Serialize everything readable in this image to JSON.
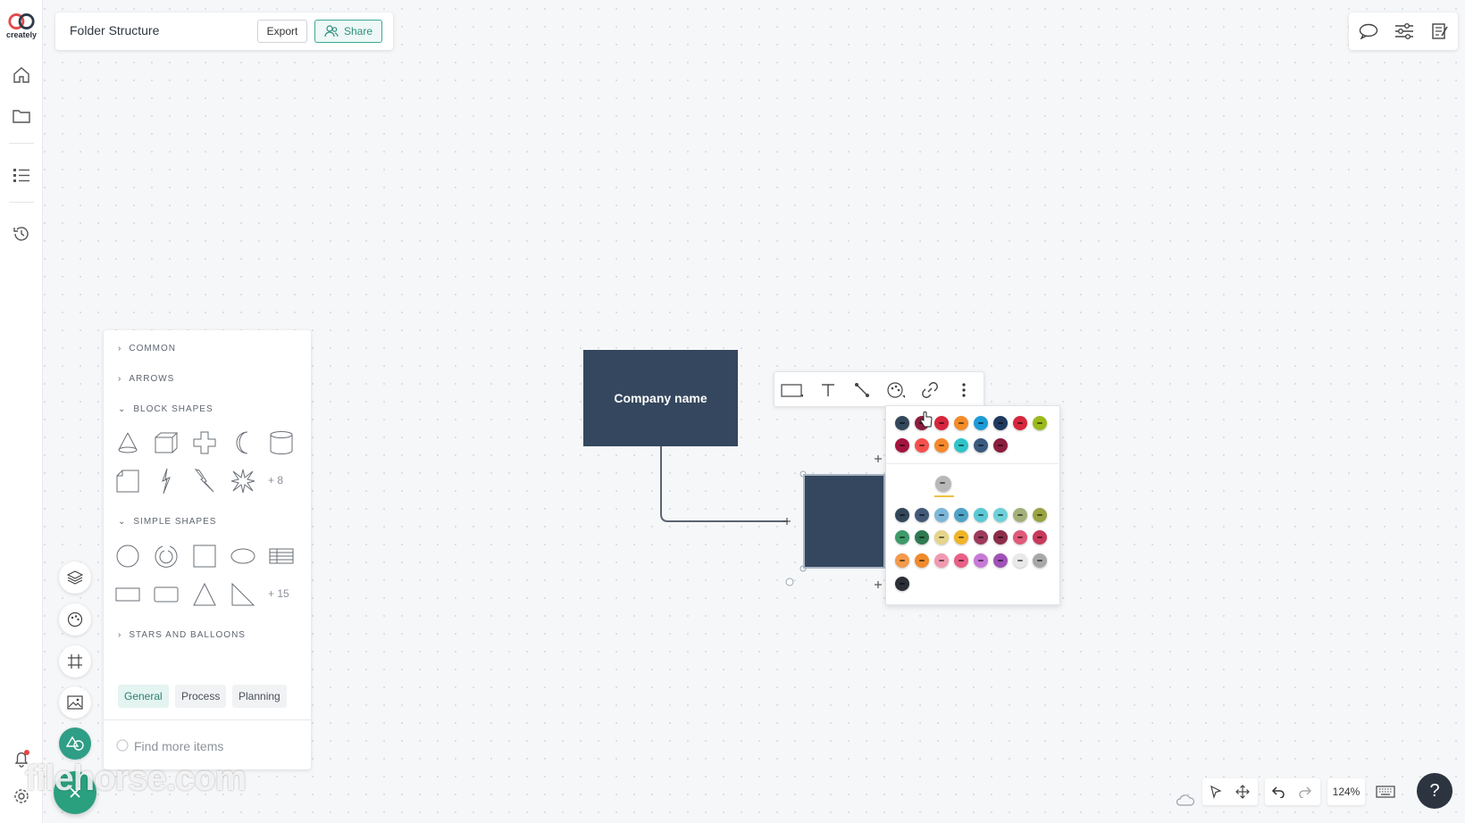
{
  "app": {
    "logo_text": "creately"
  },
  "header": {
    "title": "Folder Structure",
    "export_label": "Export",
    "share_label": "Share"
  },
  "left_rail": {
    "icons": [
      "home-icon",
      "folder-icon",
      "outline-icon",
      "history-icon",
      "bell-icon",
      "gear-icon"
    ],
    "notification_color": "#e64545"
  },
  "top_right": {
    "icons": [
      "comment-icon",
      "settings-sliders-icon",
      "notes-icon"
    ]
  },
  "shapes_panel": {
    "sections": {
      "common": "COMMON",
      "arrows": "ARROWS",
      "block_shapes": "BLOCK SHAPES",
      "simple_shapes": "SIMPLE SHAPES",
      "stars_balloons": "STARS AND BALLOONS"
    },
    "block_more": "+ 8",
    "simple_more": "+ 15",
    "tabs": [
      "General",
      "Process",
      "Planning"
    ],
    "active_tab": "General",
    "search_placeholder": "Find more items"
  },
  "canvas": {
    "company_box_label": "Company name",
    "shape_fill": "#35475e"
  },
  "context_toolbar": {
    "tools": [
      "shape-icon",
      "text-icon",
      "connector-icon",
      "palette-icon",
      "link-icon",
      "more-icon"
    ]
  },
  "palette": {
    "row1": [
      "#33475b",
      "#8c1d3e",
      "#d7263d",
      "#f28c28",
      "#1e9bd7",
      "#1f3a5f",
      "#d7263d",
      "#9bb91a"
    ],
    "row2": [
      "#a3153f",
      "#f4514e",
      "#f5892b",
      "#2ec4c9",
      "#3b5a80",
      "#8c1d3e"
    ],
    "selected_preview": "#b8b8b8",
    "theme_row1": [
      "#33475b",
      "#415a77",
      "#7cb7d9",
      "#4fa3c7",
      "#5bc8d5",
      "#6dd1d8",
      "#a4b07a",
      "#9aa342"
    ],
    "theme_row2": [
      "#3e9a6a",
      "#2f7a52",
      "#e5d48a",
      "#f0b429",
      "#9c3b5b",
      "#8c2d4a",
      "#e05a7a",
      "#c73a5a"
    ],
    "theme_row3": [
      "#f39a4b",
      "#f08a2c",
      "#f09ab1",
      "#ea5f86",
      "#c879d8",
      "#a052b8",
      "#e9e9e9",
      "#a8a8a8"
    ],
    "theme_row4": [
      "#2b2f36"
    ]
  },
  "bottom": {
    "zoom": "124%",
    "help": "?"
  },
  "watermark": "filehorse.com"
}
